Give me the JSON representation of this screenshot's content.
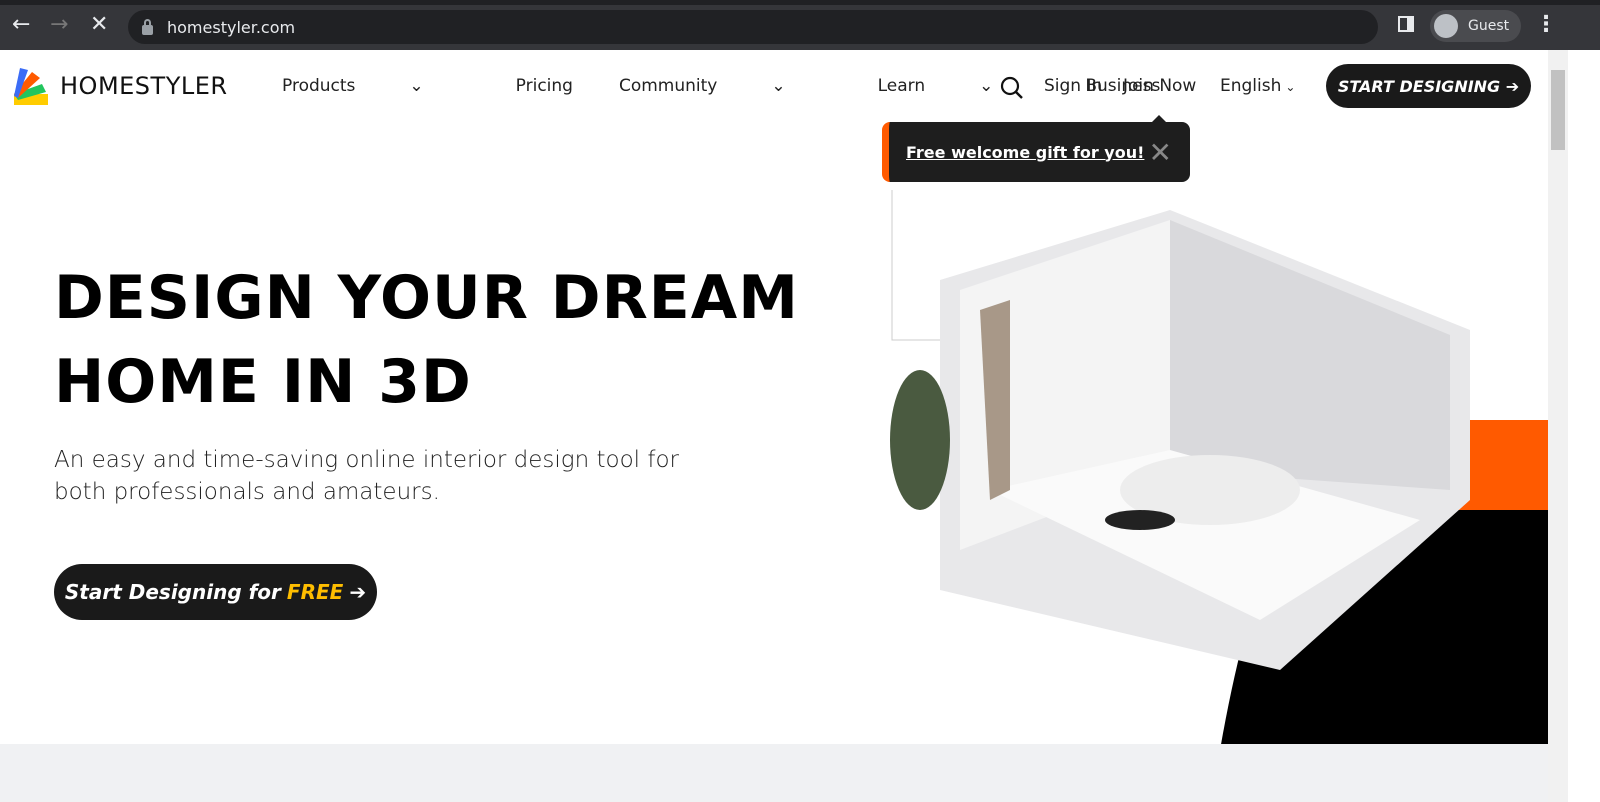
{
  "browser": {
    "url": "homestyler.com",
    "profile": "Guest",
    "back": "←",
    "forward": "→",
    "stop": "✕",
    "menu": "⋮"
  },
  "header": {
    "logo": "HOMESTYLER",
    "nav": [
      {
        "label": "Products",
        "dropdown": true
      },
      {
        "label": "Pricing"
      },
      {
        "label": "Community",
        "dropdown": true
      },
      {
        "label": "Learn",
        "dropdown": true
      },
      {
        "label": "Business"
      }
    ],
    "sign_in": "Sign In",
    "join_now": "Join Now",
    "language": "English",
    "start": "START DESIGNING"
  },
  "popup": {
    "text": "Free welcome gift for you!",
    "close": "✕"
  },
  "hero": {
    "title_line1": "DESIGN YOUR DREAM",
    "title_line2": "HOME IN 3D",
    "subtitle": "An easy and time-saving online interior design tool for both professionals and amateurs.",
    "cta_prefix": "Start Designing for",
    "cta_free": "FREE",
    "arrow": "➔"
  },
  "colors": {
    "accent": "#ff5a00",
    "dark": "#1a1a1a",
    "free": "#ffbe00"
  }
}
